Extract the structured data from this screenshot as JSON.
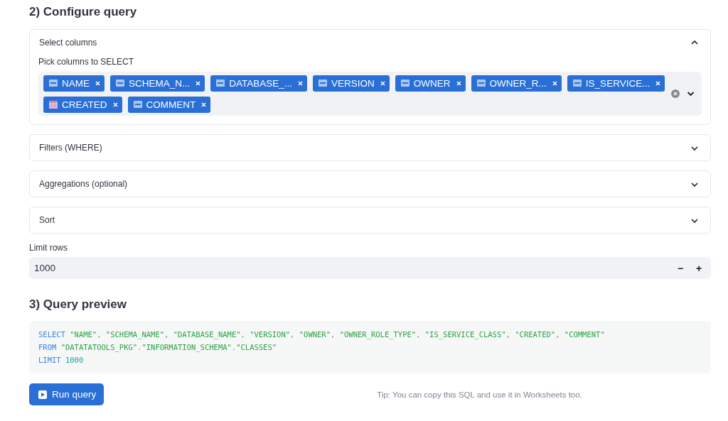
{
  "configure": {
    "title": "2) Configure query",
    "sections": [
      {
        "label": "Select columns",
        "expanded": true,
        "field_label": "Pick columns to SELECT",
        "chips": [
          {
            "label": "NAME",
            "kind": "text"
          },
          {
            "label": "SCHEMA_N...",
            "kind": "text"
          },
          {
            "label": "DATABASE_...",
            "kind": "text"
          },
          {
            "label": "VERSION",
            "kind": "text"
          },
          {
            "label": "OWNER",
            "kind": "text"
          },
          {
            "label": "OWNER_R...",
            "kind": "text"
          },
          {
            "label": "IS_SERVICE...",
            "kind": "text"
          },
          {
            "label": "CREATED",
            "kind": "date"
          },
          {
            "label": "COMMENT",
            "kind": "text"
          }
        ]
      },
      {
        "label": "Filters (WHERE)",
        "expanded": false
      },
      {
        "label": "Aggregations (optional)",
        "expanded": false
      },
      {
        "label": "Sort",
        "expanded": false
      }
    ],
    "limit": {
      "label": "Limit rows",
      "value": "1000",
      "decrement": "−",
      "increment": "+"
    }
  },
  "preview": {
    "title": "3) Query preview",
    "lines": [
      [
        {
          "kind": "keyword",
          "text": "SELECT"
        },
        {
          "kind": "string",
          "text": "\"NAME\""
        },
        {
          "kind": "punct",
          "text": ","
        },
        {
          "kind": "string",
          "text": "\"SCHEMA_NAME\""
        },
        {
          "kind": "punct",
          "text": ","
        },
        {
          "kind": "string",
          "text": "\"DATABASE_NAME\""
        },
        {
          "kind": "punct",
          "text": ","
        },
        {
          "kind": "string",
          "text": "\"VERSION\""
        },
        {
          "kind": "punct",
          "text": ","
        },
        {
          "kind": "string",
          "text": "\"OWNER\""
        },
        {
          "kind": "punct",
          "text": ","
        },
        {
          "kind": "string",
          "text": "\"OWNER_ROLE_TYPE\""
        },
        {
          "kind": "punct",
          "text": ","
        },
        {
          "kind": "string",
          "text": "\"IS_SERVICE_CLASS\""
        },
        {
          "kind": "punct",
          "text": ","
        },
        {
          "kind": "string",
          "text": "\"CREATED\""
        },
        {
          "kind": "punct",
          "text": ","
        },
        {
          "kind": "string",
          "text": "\"COMMENT\""
        }
      ],
      [
        {
          "kind": "keyword",
          "text": "FROM"
        },
        {
          "kind": "string",
          "text": "\"DATATATOOLS_PKG\""
        },
        {
          "kind": "punct",
          "text": "."
        },
        {
          "kind": "string",
          "text": "\"INFORMATION_SCHEMA\""
        },
        {
          "kind": "punct",
          "text": "."
        },
        {
          "kind": "string",
          "text": "\"CLASSES\""
        }
      ],
      [
        {
          "kind": "keyword",
          "text": "LIMIT"
        },
        {
          "kind": "number",
          "text": "1000"
        }
      ]
    ],
    "run_button": "Run query",
    "tip": "Tip: You can copy this SQL and use it in Worksheets too."
  }
}
